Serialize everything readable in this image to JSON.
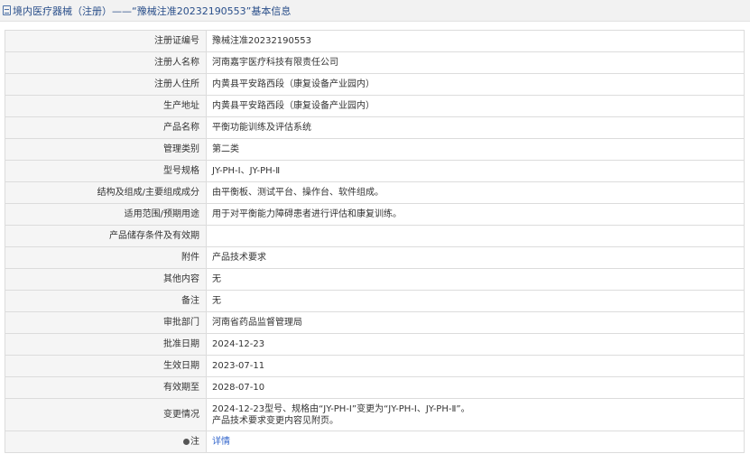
{
  "header": {
    "title": "境内医疗器械（注册）——“豫械注准20232190553”基本信息",
    "icon": "document-icon"
  },
  "rows": [
    {
      "label": "注册证编号",
      "value": "豫械注准20232190553"
    },
    {
      "label": "注册人名称",
      "value": "河南嘉宇医疗科技有限责任公司"
    },
    {
      "label": "注册人住所",
      "value": "内黄县平安路西段（康复设备产业园内）"
    },
    {
      "label": "生产地址",
      "value": "内黄县平安路西段（康复设备产业园内）"
    },
    {
      "label": "产品名称",
      "value": "平衡功能训练及评估系统"
    },
    {
      "label": "管理类别",
      "value": "第二类"
    },
    {
      "label": "型号规格",
      "value": "JY-PH-Ⅰ、JY-PH-Ⅱ"
    },
    {
      "label": "结构及组成/主要组成成分",
      "value": "由平衡板、测试平台、操作台、软件组成。"
    },
    {
      "label": "适用范围/预期用途",
      "value": "用于对平衡能力障碍患者进行评估和康复训练。"
    },
    {
      "label": "产品储存条件及有效期",
      "value": ""
    },
    {
      "label": "附件",
      "value": "产品技术要求"
    },
    {
      "label": "其他内容",
      "value": "无"
    },
    {
      "label": "备注",
      "value": "无"
    },
    {
      "label": "审批部门",
      "value": "河南省药品监督管理局"
    },
    {
      "label": "批准日期",
      "value": "2024-12-23"
    },
    {
      "label": "生效日期",
      "value": "2023-07-11"
    },
    {
      "label": "有效期至",
      "value": "2028-07-10"
    }
  ],
  "change_row": {
    "label": "变更情况",
    "line1": "2024-12-23型号、规格由“JY-PH-I”变更为“JY-PH-Ⅰ、JY-PH-Ⅱ”。",
    "line2": "产品技术要求变更内容见附页。"
  },
  "note_row": {
    "label": "注",
    "icon": "note-icon",
    "link_text": "详情"
  }
}
